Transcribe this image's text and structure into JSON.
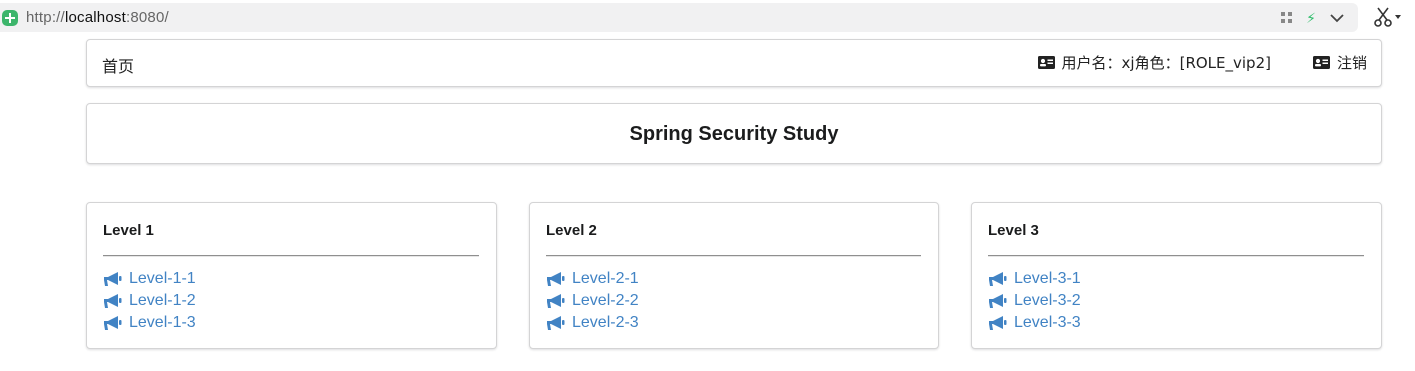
{
  "browser": {
    "url_prefix": "http://",
    "url_host": "localhost",
    "url_suffix": ":8080/"
  },
  "nav": {
    "home_label": "首页",
    "user_info": "用户名：xj角色：[ROLE_vip2]",
    "logout_label": "注销"
  },
  "header": {
    "title": "Spring Security Study"
  },
  "levels": [
    {
      "title": "Level 1",
      "links": [
        "Level-1-1",
        "Level-1-2",
        "Level-1-3"
      ]
    },
    {
      "title": "Level 2",
      "links": [
        "Level-2-1",
        "Level-2-2",
        "Level-2-3"
      ]
    },
    {
      "title": "Level 3",
      "links": [
        "Level-3-1",
        "Level-3-2",
        "Level-3-3"
      ]
    }
  ],
  "colors": {
    "link": "#4183c4",
    "secure_badge": "#3cb56b",
    "border": "#d4d4d5"
  },
  "icons": {
    "card": "id-card-icon",
    "link": "megaphone-icon"
  }
}
